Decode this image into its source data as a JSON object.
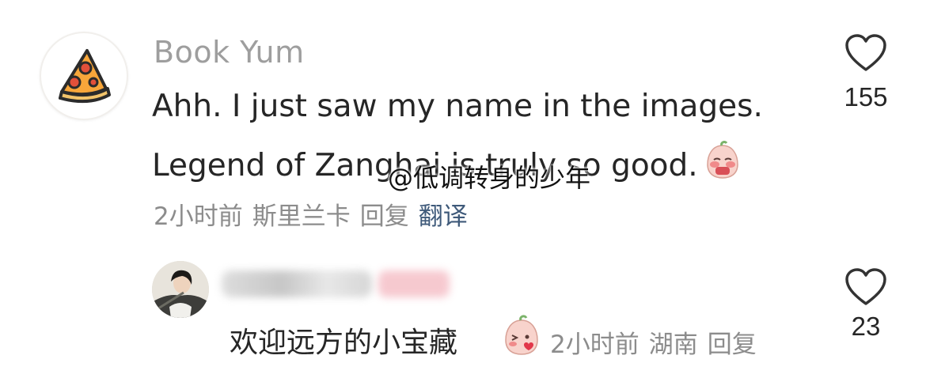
{
  "comment": {
    "username": "Book Yum",
    "avatar_icon": "pizza-icon",
    "text_line1": "Ahh. I just saw my name in the images.",
    "text_line2": "Legend of Zanghai is truly so good.",
    "emoji": "blushing-peach-emoji",
    "time": "2小时前",
    "location": "斯里兰卡",
    "reply_label": "回复",
    "translate_label": "翻译",
    "like_count": "155"
  },
  "watermark": "@低调转身的少年",
  "reply": {
    "text": "欢迎远方的小宝藏",
    "emoji": "kissing-peach-emoji",
    "time": "2小时前",
    "location": "湖南",
    "reply_label": "回复",
    "like_count": "23"
  },
  "colors": {
    "meta_text": "#8c8c8c",
    "translate": "#3f5a7a",
    "username": "#9e9e9e"
  }
}
